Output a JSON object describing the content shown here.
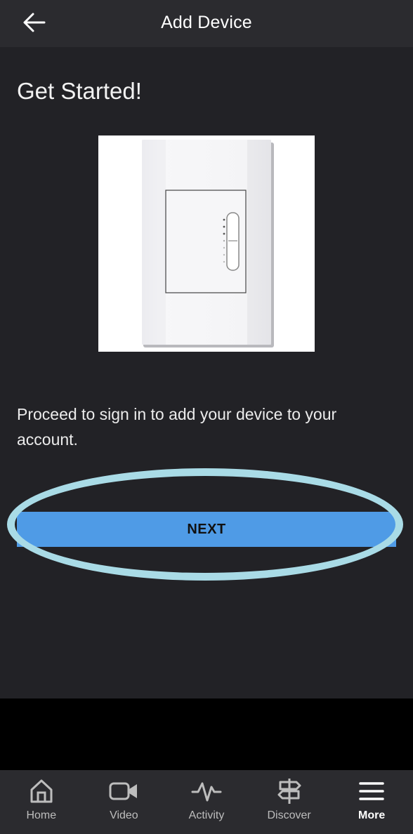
{
  "header": {
    "title": "Add Device",
    "back_icon": "arrow-left-icon"
  },
  "main": {
    "heading": "Get Started!",
    "image": "light-switch-image",
    "description": "Proceed to sign in to add your device to your account.",
    "next_label": "NEXT",
    "accent_color": "#4f9be6",
    "highlight_color": "#a9dbe6"
  },
  "tabs": [
    {
      "label": "Home",
      "icon": "home-icon",
      "active": false
    },
    {
      "label": "Video",
      "icon": "video-camera-icon",
      "active": false
    },
    {
      "label": "Activity",
      "icon": "activity-pulse-icon",
      "active": false
    },
    {
      "label": "Discover",
      "icon": "signpost-icon",
      "active": false
    },
    {
      "label": "More",
      "icon": "hamburger-menu-icon",
      "active": true
    }
  ]
}
